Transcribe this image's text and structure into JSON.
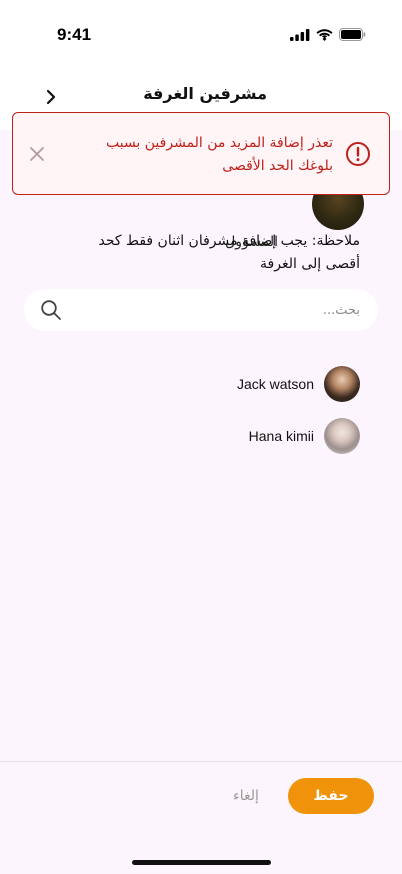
{
  "status_bar": {
    "time": "9:41",
    "icons": [
      "cellular-signal-icon",
      "wifi-icon",
      "battery-icon"
    ]
  },
  "header": {
    "title": "مشرفين الغرفة",
    "back_icon": "chevron-right-icon"
  },
  "admin": {
    "role_label": "المسؤول"
  },
  "note": {
    "text": "ملاحظة: يجب إضافة مشرفان اثنان فقط كحد أقصى إلى الغرفة"
  },
  "search": {
    "placeholder": "بحث...",
    "value": "",
    "icon": "search-icon"
  },
  "members": [
    {
      "name": "Jack watson"
    },
    {
      "name": "Hana kimii"
    }
  ],
  "footer": {
    "save_label": "حفظ",
    "cancel_label": "إلغاء"
  },
  "toast": {
    "message": "تعذر إضافة المزيد من المشرفين بسبب بلوغك الحد الأقصى",
    "icon": "exclamation-circle-icon",
    "close_icon": "close-icon"
  },
  "colors": {
    "accent": "#f0920a",
    "error": "#c0201a",
    "background": "#fcf5fd"
  }
}
